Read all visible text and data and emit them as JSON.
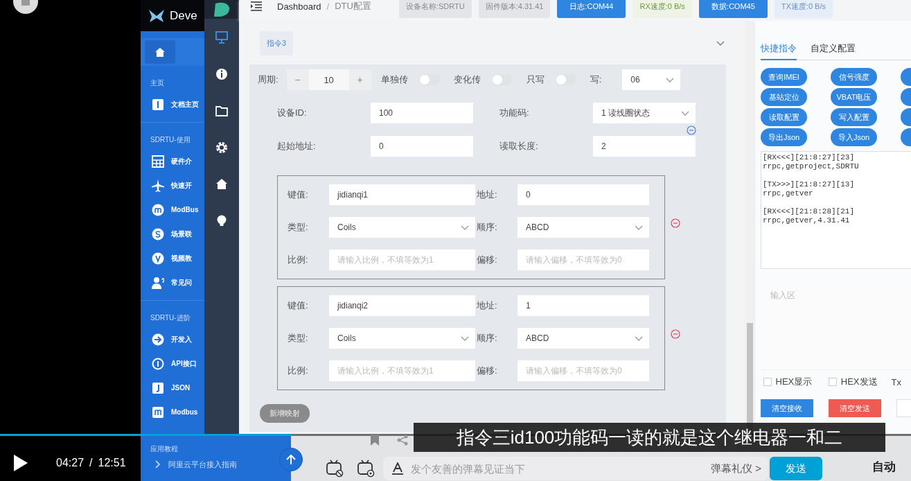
{
  "doc_sidebar": {
    "brand": "Deve",
    "sections": [
      {
        "title": "主页",
        "items": [
          "文档主页"
        ]
      },
      {
        "title": "SDRTU-使用",
        "items": [
          "硬件介",
          "快速开",
          "ModBus",
          "场景联",
          "视频教",
          "常见问"
        ]
      },
      {
        "title": "SDRTU-进阶",
        "items": [
          "开发入",
          "API接口",
          "JSON",
          "Modbus"
        ]
      }
    ],
    "bottom_section": {
      "title": "应用教程",
      "items": [
        "阿里云平台接入指南"
      ]
    }
  },
  "topbar": {
    "breadcrumb": [
      "Dashboard",
      "DTU配置"
    ],
    "breadcrumb_separator": "/",
    "tags": [
      {
        "text": "设备名称:SDRTU",
        "kind": "plain"
      },
      {
        "text": "固件版本:4.31.41",
        "kind": "plain"
      },
      {
        "text": "日志:COM44",
        "kind": "port"
      },
      {
        "text": "RX速度:0 B/s",
        "kind": "rx"
      },
      {
        "text": "数据:COM45",
        "kind": "port"
      },
      {
        "text": "TX速度:0 B/s",
        "kind": "tx"
      }
    ]
  },
  "command_panel": {
    "tag": "指令3",
    "expanded": true,
    "period": {
      "label": "周期:",
      "minus": "−",
      "value": "10",
      "plus": "+"
    },
    "toggles": [
      {
        "label": "单独传",
        "on": false
      },
      {
        "label": "变化传",
        "on": false
      },
      {
        "label": "只写",
        "on": false
      }
    ],
    "write": {
      "label": "写:",
      "value": "06"
    },
    "fields": [
      {
        "label": "设备ID:",
        "value": "100",
        "kind": "input"
      },
      {
        "label": "功能码:",
        "value": "1 读线圈状态",
        "kind": "select"
      },
      {
        "label": "起始地址:",
        "value": "0",
        "kind": "input"
      },
      {
        "label": "读取长度:",
        "value": "2",
        "kind": "input"
      }
    ],
    "mappings": [
      {
        "key": {
          "label": "键值:",
          "value": "jidianqi1"
        },
        "address": {
          "label": "地址:",
          "value": "0"
        },
        "type": {
          "label": "类型:",
          "value": "Coils"
        },
        "order": {
          "label": "顺序:",
          "value": "ABCD"
        },
        "scale": {
          "label": "比例:",
          "placeholder": "请输入比例，不填等效为1"
        },
        "offset": {
          "label": "偏移:",
          "placeholder": "请输入偏移，不填等效为0"
        }
      },
      {
        "key": {
          "label": "键值:",
          "value": "jidianqi2"
        },
        "address": {
          "label": "地址:",
          "value": "1"
        },
        "type": {
          "label": "类型:",
          "value": "Coils"
        },
        "order": {
          "label": "顺序:",
          "value": "ABCD"
        },
        "scale": {
          "label": "比例:",
          "placeholder": "请输入比例，不填等效为1"
        },
        "offset": {
          "label": "偏移:",
          "placeholder": "请输入偏移，不填等效为0"
        }
      }
    ],
    "add_button": "新增映射"
  },
  "right_panel": {
    "tabs": [
      {
        "label": "快捷指令",
        "selected": true
      },
      {
        "label": "自定义配置",
        "selected": false
      }
    ],
    "quick_buttons": [
      "查询IMEI",
      "信号强度",
      "基站定位",
      "VBAT电压",
      "读取配置",
      "写入配置",
      "导出Json",
      "导入Json"
    ],
    "log": [
      {
        "header": "[RX<<<][21:8:27][23]",
        "body": "rrpc,getproject,SDRTU"
      },
      {
        "header": "[TX>>>][21:8:27][13]",
        "body": "rrpc,getver"
      },
      {
        "header": "[RX<<<][21:8:28][21]",
        "body": "rrpc,getver,4.31.41"
      }
    ],
    "input": {
      "placeholder": "输入区"
    },
    "options": [
      {
        "label": "HEX显示",
        "checked": false
      },
      {
        "label": "HEX发送",
        "checked": false
      }
    ],
    "option_partial": "Tx",
    "actions": [
      {
        "label": "清空接收",
        "kind": "primary"
      },
      {
        "label": "清空发送",
        "kind": "danger"
      }
    ]
  },
  "player": {
    "subtitle": "指令三id100功能码一读的就是这个继电器一和二",
    "progress": {
      "level": 0.32
    },
    "time_current": "04:27",
    "time_separator": "/",
    "time_total": "12:51",
    "danmaku_input": {
      "placeholder": "发个友善的弹幕见证当下"
    },
    "danmaku_etiquette": "弹幕礼仪 >",
    "send_button": "发送",
    "quality": "自动"
  }
}
